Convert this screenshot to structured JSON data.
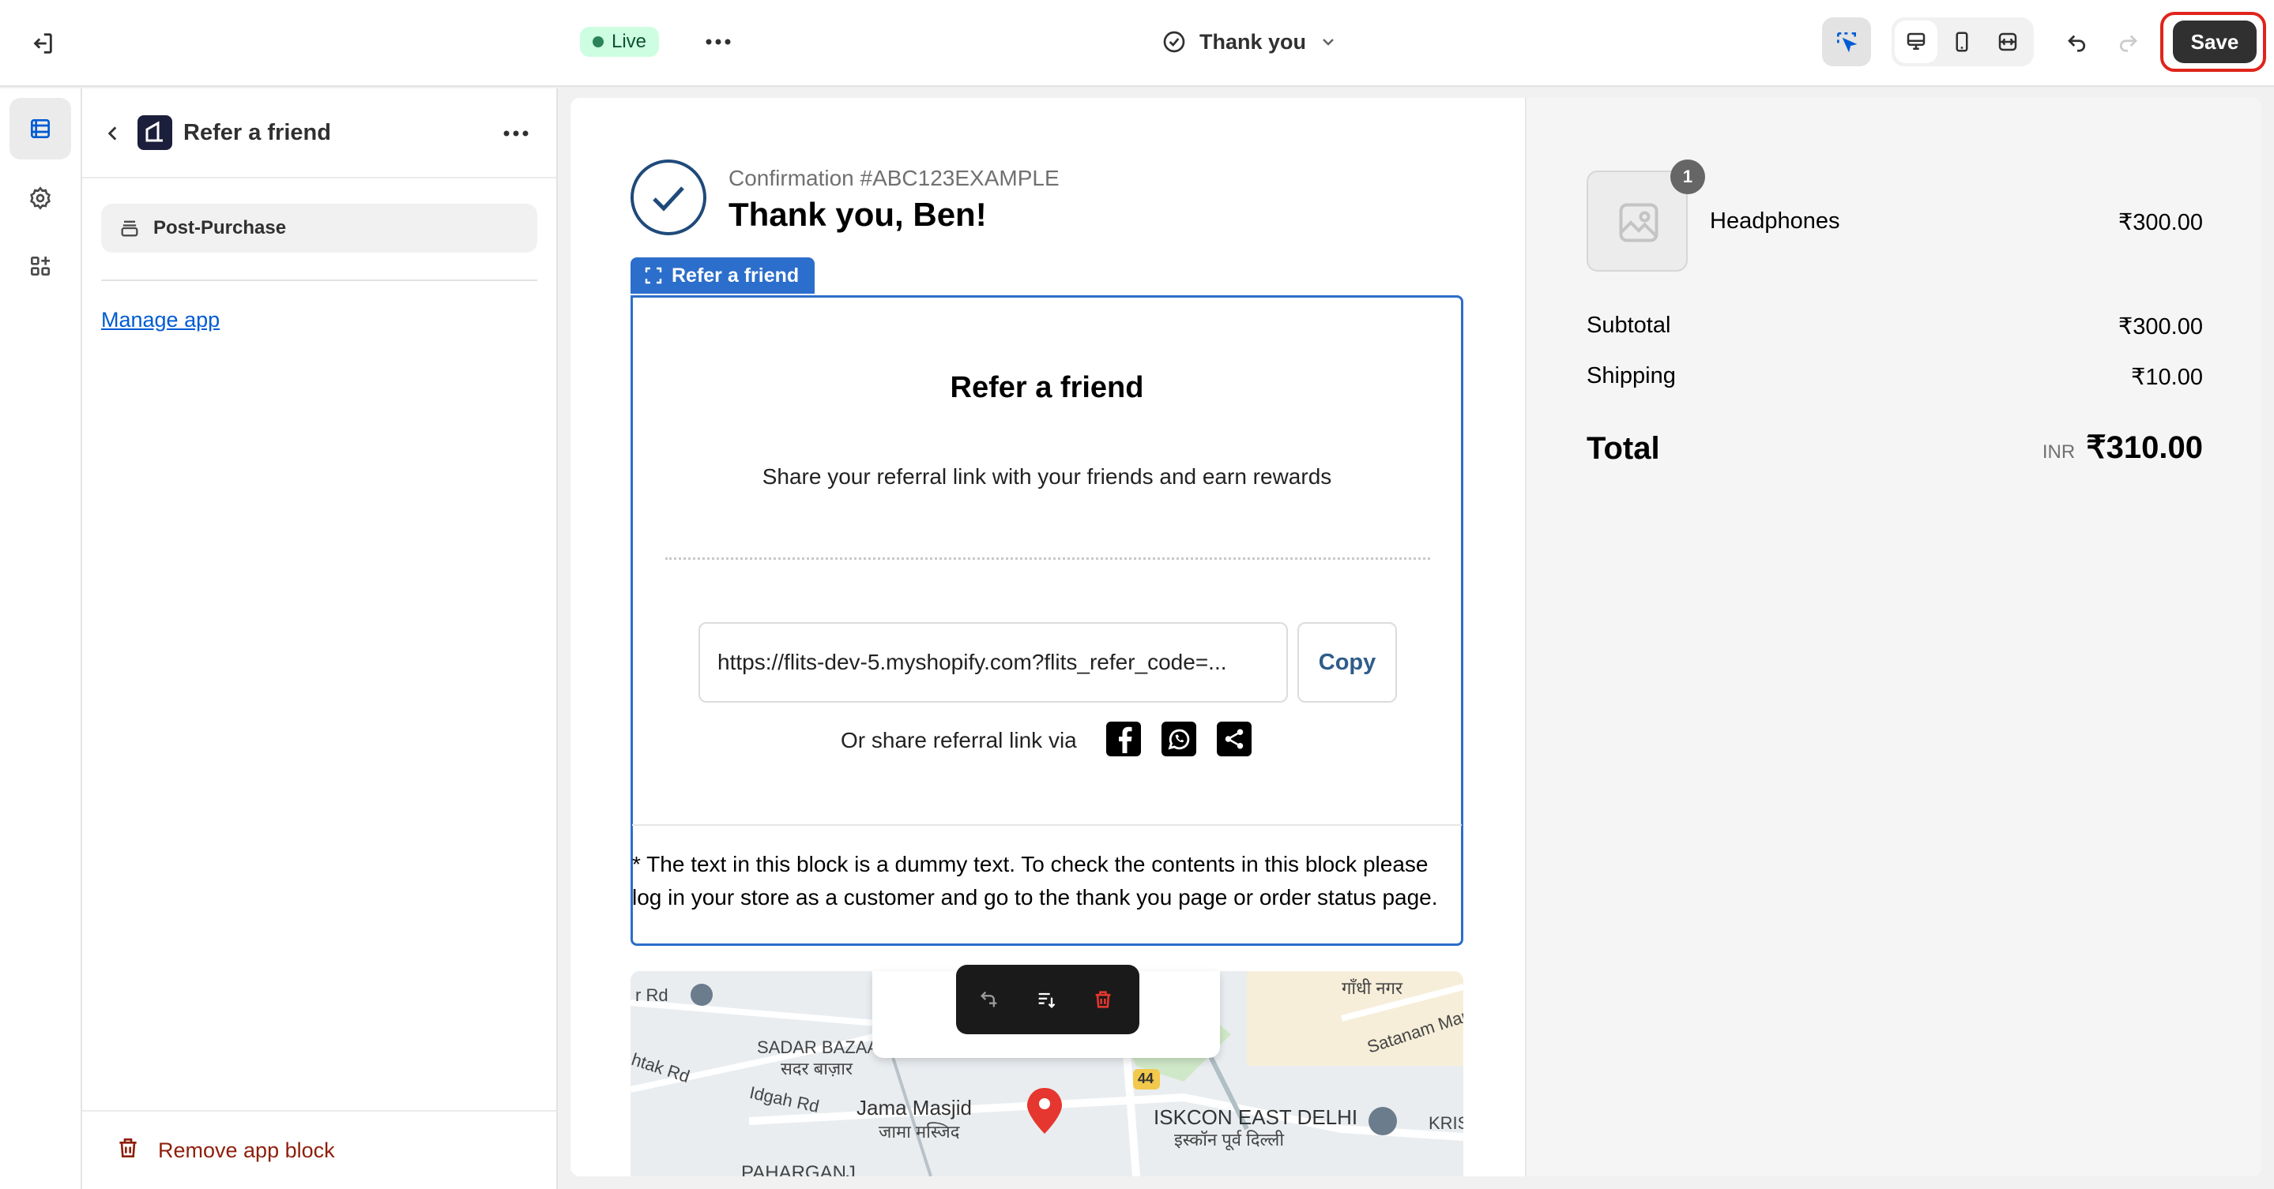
{
  "topbar": {
    "status": "Live",
    "template": "Thank you",
    "save_label": "Save"
  },
  "sidebar": {
    "title": "Refer a friend",
    "section_item": "Post-Purchase",
    "manage_link": "Manage app",
    "remove_label": "Remove app block"
  },
  "preview": {
    "confirmation": "Confirmation #ABC123EXAMPLE",
    "greeting": "Thank you, Ben!",
    "block_tab": "Refer a friend",
    "refer_title": "Refer a friend",
    "refer_subtitle": "Share your referral link with your friends and earn rewards",
    "referral_link": "https://flits-dev-5.myshopify.com?flits_refer_code=...",
    "copy_label": "Copy",
    "share_label": "Or share referral link via",
    "dummy_note": "* The text in this block is a dummy text. To check the contents in this block please log in your store as a customer and go to the thank you page or order status page.",
    "map_labels": {
      "rd": "r Rd",
      "gandhi_nagar": "गाँधी नगर",
      "sadar_bazaar": "SADAR BAZAAR",
      "sadar_bazaar_hi": "सदर बाज़ार",
      "rohtak_rd": "htak Rd",
      "idgah_rd": "Idgah Rd",
      "jama_masjid": "Jama Masjid",
      "jama_masjid_hi": "जामा मस्जिद",
      "iskcon": "ISKCON EAST DELHI",
      "iskcon_hi": "इस्कॉन पूर्व दिल्ली",
      "satanam": "Satanam Mar",
      "kris": "KRIS",
      "highway": "44",
      "paharganj": "PAHARGANJ"
    }
  },
  "summary": {
    "quantity": "1",
    "product": "Headphones",
    "product_price": "₹300.00",
    "subtotal_label": "Subtotal",
    "subtotal_value": "₹300.00",
    "shipping_label": "Shipping",
    "shipping_value": "₹10.00",
    "total_label": "Total",
    "currency": "INR",
    "total_value": "₹310.00"
  },
  "colors": {
    "accent": "#2c6ecb",
    "save_highlight": "#e0241b",
    "live_badge": "#cdfee1",
    "destructive": "#8e1f0b"
  }
}
